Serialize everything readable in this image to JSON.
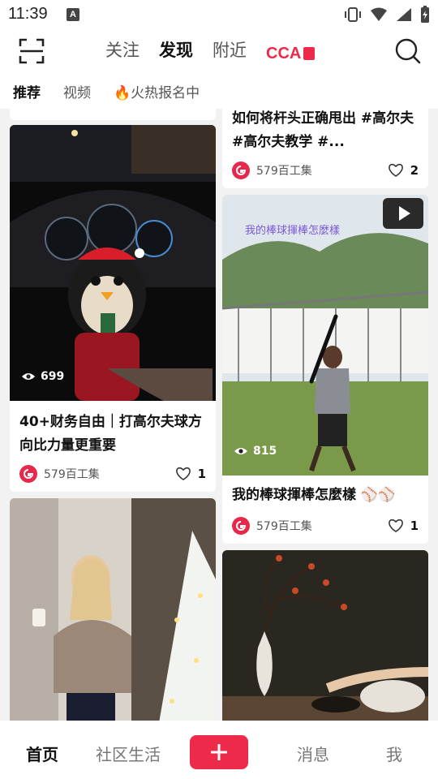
{
  "status": {
    "time": "11:39",
    "a_badge": "A"
  },
  "top_nav": {
    "tabs": [
      {
        "label": "关注"
      },
      {
        "label": "发现"
      },
      {
        "label": "附近"
      }
    ],
    "cca_label": "CCA"
  },
  "sub_tabs": [
    {
      "label": "推荐"
    },
    {
      "label": "视频"
    },
    {
      "label": "火热报名中"
    }
  ],
  "feed": {
    "left": [
      {
        "views": "699",
        "title": "40+财务自由｜打高尔夫球方向比力量更重要",
        "author": "579百工集",
        "likes": "1"
      },
      {
        "title": "",
        "author": ""
      }
    ],
    "right": [
      {
        "title": "如何将杆头正确甩出 #高尔夫 #高尔夫教学 #...",
        "author": "579百工集",
        "likes": "2"
      },
      {
        "overlay_text": "我的棒球揮棒怎麼樣",
        "views": "815",
        "title": "我的棒球揮棒怎麼樣 ⚾⚾",
        "author": "579百工集",
        "likes": "1"
      }
    ]
  },
  "bottom_nav": {
    "home": "首页",
    "community": "社区生活",
    "messages": "消息",
    "me": "我"
  },
  "colors": {
    "accent": "#ee2a4a"
  }
}
